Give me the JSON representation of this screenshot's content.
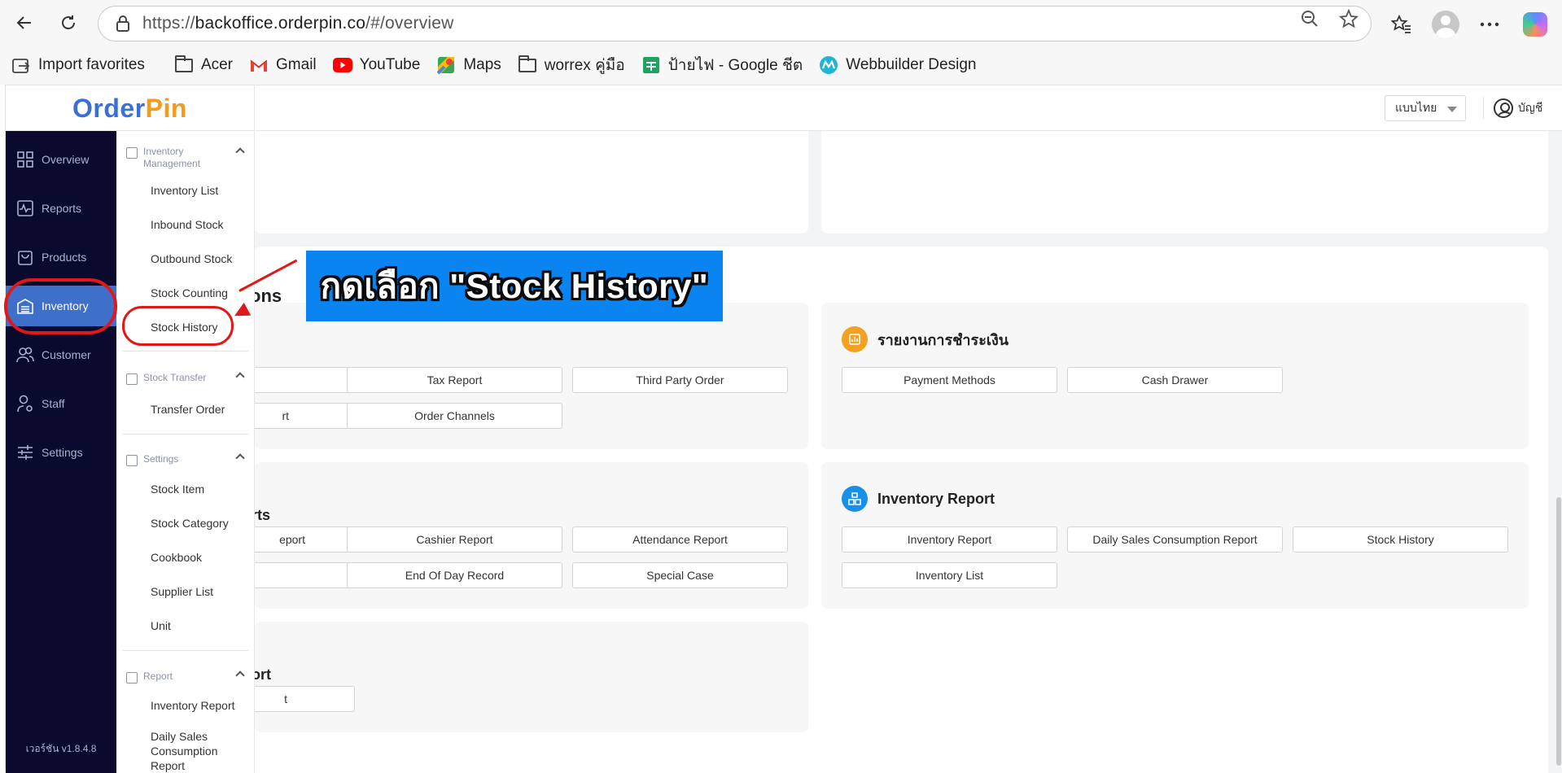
{
  "browser": {
    "url_prefix": "https://",
    "url_host": "backoffice.orderpin.co",
    "url_path": "/#/overview",
    "bookmarks": [
      {
        "label": "Import favorites",
        "icon": "import-icon"
      },
      {
        "label": "Acer",
        "icon": "folder-icon"
      },
      {
        "label": "Gmail",
        "icon": "gmail-icon"
      },
      {
        "label": "YouTube",
        "icon": "youtube-icon"
      },
      {
        "label": "Maps",
        "icon": "maps-icon"
      },
      {
        "label": "worrex คู่มือ",
        "icon": "folder-icon"
      },
      {
        "label": "ป้ายไฟ - Google ชีต",
        "icon": "sheets-icon"
      },
      {
        "label": "Webbuilder Design",
        "icon": "webbuilder-icon"
      }
    ]
  },
  "header": {
    "logo_part1": "Order",
    "logo_part2": "Pin",
    "language": "แบบไทย",
    "account": "บัญชี"
  },
  "sidebar": {
    "items": [
      {
        "label": "Overview",
        "icon": "grid-icon"
      },
      {
        "label": "Reports",
        "icon": "pulse-icon"
      },
      {
        "label": "Products",
        "icon": "bag-icon"
      },
      {
        "label": "Inventory",
        "icon": "warehouse-icon"
      },
      {
        "label": "Customer",
        "icon": "users-icon"
      },
      {
        "label": "Staff",
        "icon": "staff-icon"
      },
      {
        "label": "Settings",
        "icon": "sliders-icon"
      }
    ],
    "version": "เวอร์ชัน v1.8.4.8"
  },
  "submenu": {
    "inventory_management": {
      "title_line1": "Inventory",
      "title_line2": "Management",
      "items": [
        "Inventory List",
        "Inbound Stock",
        "Outbound Stock",
        "Stock Counting",
        "Stock History"
      ]
    },
    "stock_transfer": {
      "title": "Stock Transfer",
      "items": [
        "Transfer Order"
      ]
    },
    "settings": {
      "title": "Settings",
      "items": [
        "Stock Item",
        "Stock Category",
        "Cookbook",
        "Supplier List",
        "Unit"
      ]
    },
    "report": {
      "title": "Report",
      "items": [
        "Inventory Report",
        "Daily Sales",
        "Consumption",
        "Report"
      ]
    }
  },
  "main": {
    "section_partial": "ons",
    "payment_card": {
      "title": "รายงานการชำระเงิน",
      "buttons": [
        "Payment Methods",
        "Cash Drawer"
      ]
    },
    "sales_card": {
      "buttons_row1": [
        "Tax Report",
        "Third Party Order"
      ],
      "buttons_row2": [
        "rt",
        "Order Channels"
      ]
    },
    "staff_card": {
      "title_partial": "rts",
      "buttons_row1": [
        "eport",
        "Cashier Report",
        "Attendance Report"
      ],
      "buttons_row2": [
        "End Of Day Record",
        "Special Case"
      ]
    },
    "inventory_card": {
      "title": "Inventory Report",
      "buttons_row1": [
        "Inventory Report",
        "Daily Sales Consumption Report",
        "Stock History"
      ],
      "buttons_row2": [
        "Inventory List"
      ]
    },
    "bottom_card": {
      "title_partial": "ort",
      "button_partial": "t"
    }
  },
  "annotation": {
    "callout": "กดเลือก \"Stock History\""
  }
}
